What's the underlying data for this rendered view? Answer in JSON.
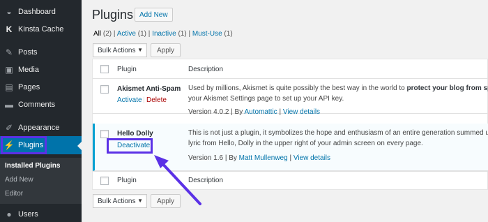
{
  "sidebar": {
    "items": [
      {
        "label": "Dashboard",
        "icon": "dashboard-icon",
        "glyph": "◒"
      },
      {
        "label": "Kinsta Cache",
        "icon": "kinsta-icon",
        "glyph": "K"
      },
      {
        "label": "Posts",
        "icon": "pin-icon",
        "glyph": "✎"
      },
      {
        "label": "Media",
        "icon": "media-icon",
        "glyph": "▣"
      },
      {
        "label": "Pages",
        "icon": "pages-icon",
        "glyph": "▤"
      },
      {
        "label": "Comments",
        "icon": "comment-icon",
        "glyph": "▬"
      },
      {
        "label": "Appearance",
        "icon": "brush-icon",
        "glyph": "✐"
      },
      {
        "label": "Plugins",
        "icon": "plug-icon",
        "glyph": "⚡"
      },
      {
        "label": "Users",
        "icon": "user-icon",
        "glyph": "●"
      }
    ],
    "submenu": [
      "Installed Plugins",
      "Add New",
      "Editor"
    ]
  },
  "header": {
    "title": "Plugins",
    "add_new": "Add New"
  },
  "filters": {
    "all": "All",
    "all_count": "(2)",
    "active": "Active",
    "active_count": "(1)",
    "inactive": "Inactive",
    "inactive_count": "(1)",
    "mustuse": "Must-Use",
    "mustuse_count": "(1)",
    "sep": "|"
  },
  "bulk": {
    "label": "Bulk Actions",
    "apply": "Apply"
  },
  "table": {
    "col_plugin": "Plugin",
    "col_description": "Description",
    "plugins": [
      {
        "name": "Akismet Anti-Spam",
        "action1": "Activate",
        "action2": "Delete",
        "desc_before": "Used by millions, Akismet is quite possibly the best way in the world to ",
        "desc_bold": "protect your blog from spam.",
        "desc_line2": "your Akismet Settings page to set up your API key.",
        "version": "Version 4.0.2 | By ",
        "author": "Automattic",
        "view": "View details"
      },
      {
        "name": "Hello Dolly",
        "action1": "Deactivate",
        "desc_line1": "This is not just a plugin, it symbolizes the hope and enthusiasm of an entire generation summed up in",
        "desc_line2": "lyric from Hello, Dolly in the upper right of your admin screen on every page.",
        "version": "Version 1.6 | By ",
        "author": "Matt Mullenweg",
        "view": "View details"
      }
    ]
  },
  "colors": {
    "sidebar_bg": "#23282d",
    "active_blue": "#0073aa",
    "highlight": "#5b31e6"
  }
}
